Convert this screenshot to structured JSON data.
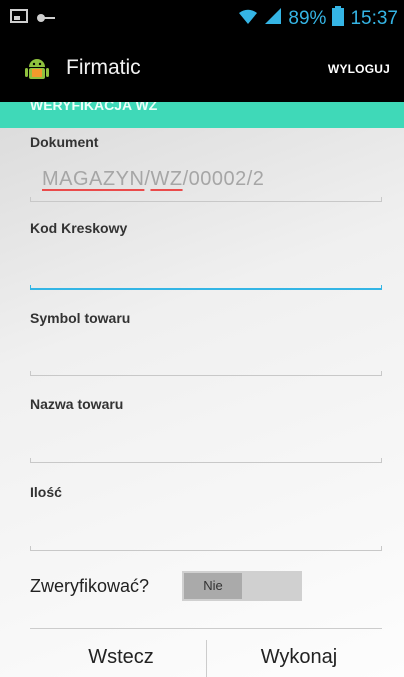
{
  "status_bar": {
    "battery": "89%",
    "time": "15:37"
  },
  "app": {
    "title": "Firmatic",
    "logout_label": "WYLOGUJ"
  },
  "section": {
    "title": "WERYFIKACJA WZ"
  },
  "form": {
    "document": {
      "label": "Dokument",
      "value_parts": [
        "MAGAZYN",
        "/",
        "WZ",
        "/00002/2"
      ]
    },
    "barcode": {
      "label": "Kod Kreskowy",
      "value": ""
    },
    "symbol": {
      "label": "Symbol towaru",
      "value": ""
    },
    "name": {
      "label": "Nazwa towaru",
      "value": ""
    },
    "quantity": {
      "label": "Ilość",
      "value": ""
    },
    "verify": {
      "label": "Zweryfikować?",
      "state": "Nie"
    }
  },
  "buttons": {
    "back": "Wstecz",
    "execute": "Wykonaj"
  },
  "colors": {
    "accent": "#33b5e5",
    "strip": "#3fd9b8",
    "status_icons": "#35b5e5"
  },
  "icons": [
    "screenshot-icon",
    "key-icon",
    "wifi-icon",
    "signal-icon",
    "battery-icon",
    "android-icon"
  ]
}
